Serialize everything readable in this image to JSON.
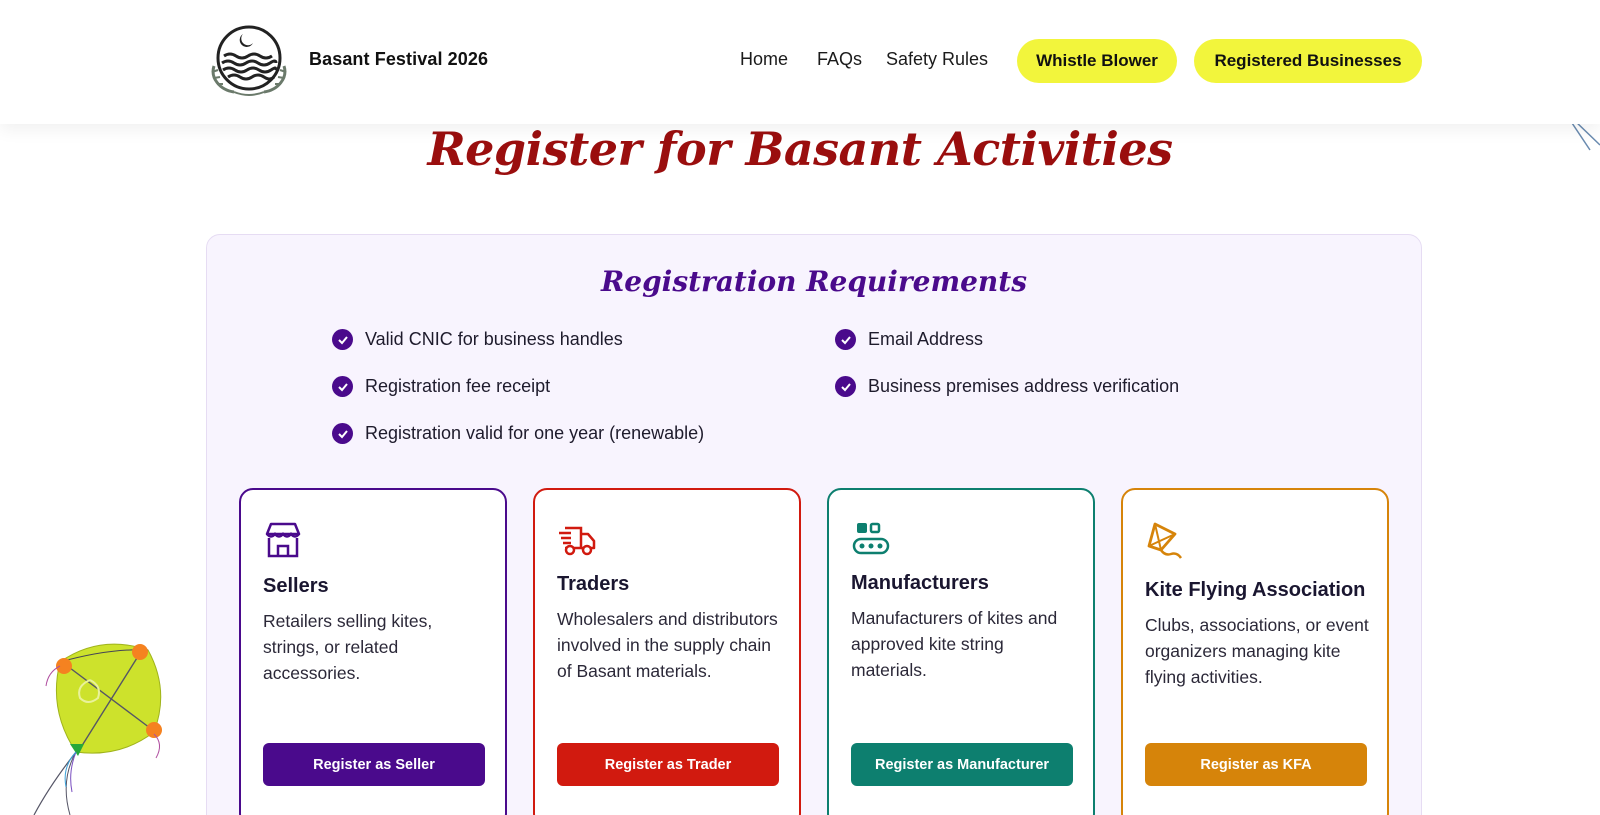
{
  "header": {
    "site_title": "Basant Festival 2026",
    "nav": [
      {
        "label": "Home"
      },
      {
        "label": "FAQs"
      },
      {
        "label": "Safety Rules"
      }
    ],
    "pills": [
      {
        "label": "Whistle Blower"
      },
      {
        "label": "Registered Businesses"
      }
    ],
    "pill_color": "#f2f53c"
  },
  "page": {
    "title": "Register for Basant Activities",
    "title_color": "#9a0e0e"
  },
  "requirements": {
    "title": "Registration Requirements",
    "items": [
      "Valid CNIC for business handles",
      "Email Address",
      "Registration fee receipt",
      "Business premises address verification",
      "Registration valid for one year (renewable)"
    ]
  },
  "cards": [
    {
      "icon": "store-icon",
      "title": "Sellers",
      "description": "Retailers selling kites, strings, or related accessories.",
      "button": "Register as Seller",
      "color": "#4a0a8c"
    },
    {
      "icon": "truck-icon",
      "title": "Traders",
      "description": "Wholesalers and distributors involved in the supply chain of Basant materials.",
      "button": "Register as Trader",
      "color": "#d11a0f"
    },
    {
      "icon": "factory-icon",
      "title": "Manufacturers",
      "description": "Manufacturers of kites and approved kite string materials.",
      "button": "Register as Manufacturer",
      "color": "#0d7f6f"
    },
    {
      "icon": "kite-icon",
      "title": "Kite Flying Association",
      "description": "Clubs, associations, or event organizers managing kite flying activities.",
      "button": "Register as KFA",
      "color": "#d6840a"
    }
  ]
}
